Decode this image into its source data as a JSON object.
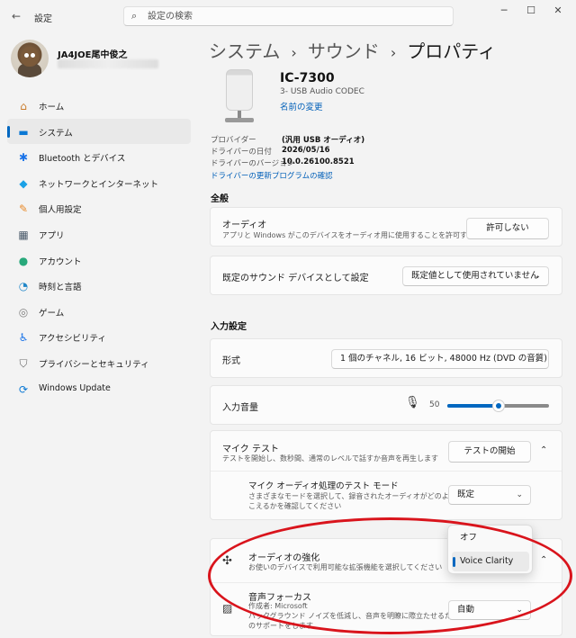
{
  "window": {
    "title": "設定",
    "back_icon": "←",
    "min_icon": "─",
    "max_icon": "☐",
    "close_icon": "✕"
  },
  "search": {
    "placeholder": "設定の検索",
    "icon": "⌕"
  },
  "user": {
    "name": "JA4JOE尾中俊之"
  },
  "sidebar": {
    "items": [
      {
        "label": "ホーム",
        "icon": "⌂",
        "color": "#c97b2a"
      },
      {
        "label": "システム",
        "icon": "▬",
        "color": "#0a78d4",
        "active": true
      },
      {
        "label": "Bluetooth とデバイス",
        "icon": "✱",
        "color": "#1a73e8"
      },
      {
        "label": "ネットワークとインターネット",
        "icon": "◆",
        "color": "#1aa1e6"
      },
      {
        "label": "個人用設定",
        "icon": "✎",
        "color": "#e88a2a"
      },
      {
        "label": "アプリ",
        "icon": "▦",
        "color": "#4a5a6a"
      },
      {
        "label": "アカウント",
        "icon": "●",
        "color": "#27a87a"
      },
      {
        "label": "時刻と言語",
        "icon": "◔",
        "color": "#1f86c8"
      },
      {
        "label": "ゲーム",
        "icon": "◎",
        "color": "#808080"
      },
      {
        "label": "アクセシビリティ",
        "icon": "♿",
        "color": "#1a73e8"
      },
      {
        "label": "プライバシーとセキュリティ",
        "icon": "⛉",
        "color": "#6b6b6b"
      },
      {
        "label": "Windows Update",
        "icon": "⟳",
        "color": "#0a78d4"
      }
    ]
  },
  "breadcrumb": {
    "part1": "システム",
    "part2": "サウンド",
    "current": "プロパティ",
    "sep": "›"
  },
  "device": {
    "name": "IC-7300",
    "subtitle": "3- USB Audio CODEC",
    "rename_link": "名前の変更"
  },
  "driver_info": {
    "rows": [
      {
        "key": "プロバイダー",
        "value": "(汎用 USB オーディオ)"
      },
      {
        "key": "ドライバーの日付",
        "value": "2026/05/16"
      },
      {
        "key": "ドライバーのバージョン",
        "value": "10.0.26100.8521"
      }
    ],
    "update_link": "ドライバーの更新プログラムの確認"
  },
  "general": {
    "heading": "全般",
    "audio": {
      "title": "オーディオ",
      "desc": "アプリと Windows がこのデバイスをオーディオ用に使用することを許可する",
      "button": "許可しない"
    },
    "default_device": {
      "title": "既定のサウンド デバイスとして設定",
      "value": "既定値として使用されていません"
    }
  },
  "input": {
    "heading": "入力設定",
    "format": {
      "title": "形式",
      "value": "1 個のチャネル, 16 ビット, 48000 Hz (DVD の音質)"
    },
    "volume": {
      "title": "入力音量",
      "value": "50",
      "level": 0.5
    },
    "mic_test": {
      "title": "マイク テスト",
      "desc": "テストを開始し、数秒間、通常のレベルで話すか音声を再生します",
      "button": "テストの開始"
    },
    "test_mode": {
      "title": "マイク オーディオ処理のテスト モード",
      "desc1": "さまざまなモードを選択して、録音されたオーディオがどのように聞",
      "desc2": "こえるかを確認してください",
      "value": "既定"
    },
    "enhancement": {
      "title": "オーディオの強化",
      "desc": "お使いのデバイスで利用可能な拡張機能を選択してください",
      "options": [
        "オフ",
        "Voice Clarity"
      ],
      "selected": "Voice Clarity"
    },
    "voice_focus": {
      "title": "音声フォーカス",
      "author": "作成者: Microsoft",
      "desc1": "バックグラウンド ノイズを低減し、音声を明瞭に際立たせるため",
      "desc2": "のサポートをします",
      "value": "自動"
    }
  },
  "colors": {
    "accent": "#0067c0",
    "highlight": "#d9141c"
  }
}
